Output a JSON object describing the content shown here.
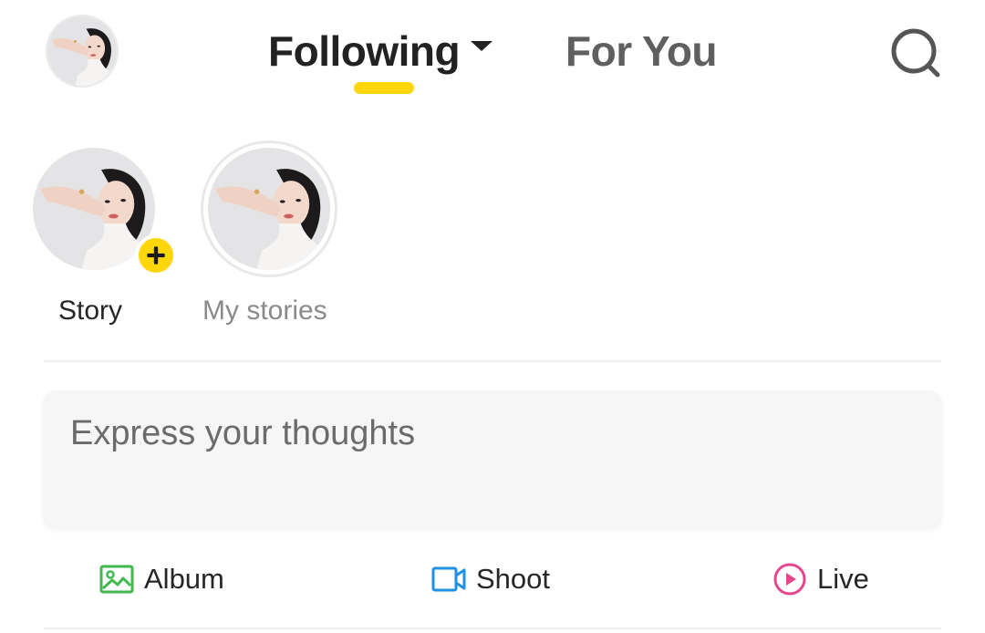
{
  "header": {
    "tabs": [
      {
        "label": "Following",
        "active": true
      },
      {
        "label": "For You",
        "active": false
      }
    ],
    "accent_color": "#ffd60a"
  },
  "stories": [
    {
      "label": "Story",
      "badge": "+"
    },
    {
      "label": "My stories"
    }
  ],
  "compose": {
    "placeholder": "Express your thoughts"
  },
  "actions": [
    {
      "label": "Album",
      "icon": "image-icon",
      "color": "#3fb950"
    },
    {
      "label": "Shoot",
      "icon": "video-camera-icon",
      "color": "#1e90e8"
    },
    {
      "label": "Live",
      "icon": "live-play-icon",
      "color": "#e6468c"
    }
  ]
}
